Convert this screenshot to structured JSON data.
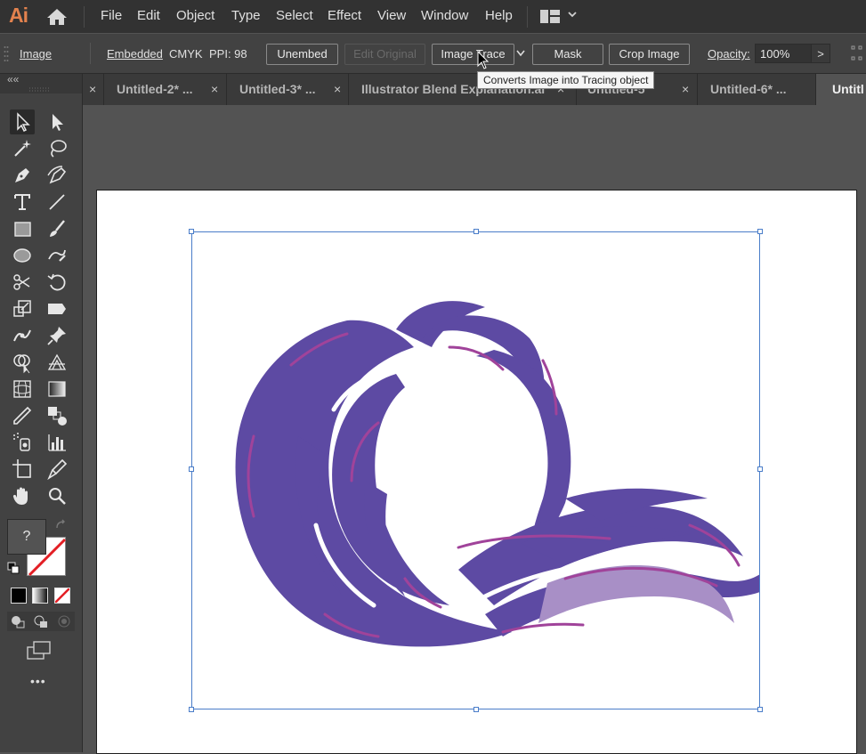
{
  "app": {
    "logo": "Ai"
  },
  "menu": [
    "File",
    "Edit",
    "Object",
    "Type",
    "Select",
    "Effect",
    "View",
    "Window",
    "Help"
  ],
  "control_bar": {
    "object_type": "Image",
    "link_state": "Embedded",
    "color_mode": "CMYK",
    "ppi": "PPI: 98",
    "unembed_label": "Unembed",
    "edit_original_label": "Edit Original",
    "image_trace_label": "Image Trace",
    "mask_label": "Mask",
    "crop_image_label": "Crop Image",
    "opacity_label": "Opacity:",
    "opacity_value": "100%",
    "more_label": ">"
  },
  "tooltip": "Converts Image into Tracing object",
  "tabs": [
    {
      "label": "Untitled-2* ...",
      "close": "×"
    },
    {
      "label": "Untitled-3* ...",
      "close": "×"
    },
    {
      "label": "Illustrator Blend Explanation.ai",
      "close": "×"
    },
    {
      "label": "Untitled-5",
      "close": "×"
    },
    {
      "label": "Untitled-6* ...",
      "close": "×"
    },
    {
      "label": "Untitl",
      "close": ""
    }
  ],
  "toolbar": {
    "collapse": "««",
    "fill_question": "?",
    "more_label": "•••"
  },
  "colors": {
    "hair_purple": "#5d4aa3",
    "hair_accent": "#a0439a",
    "hair_light": "#a88fc6",
    "selection_blue": "#4a7dc9",
    "app_orange": "#e3824e"
  }
}
